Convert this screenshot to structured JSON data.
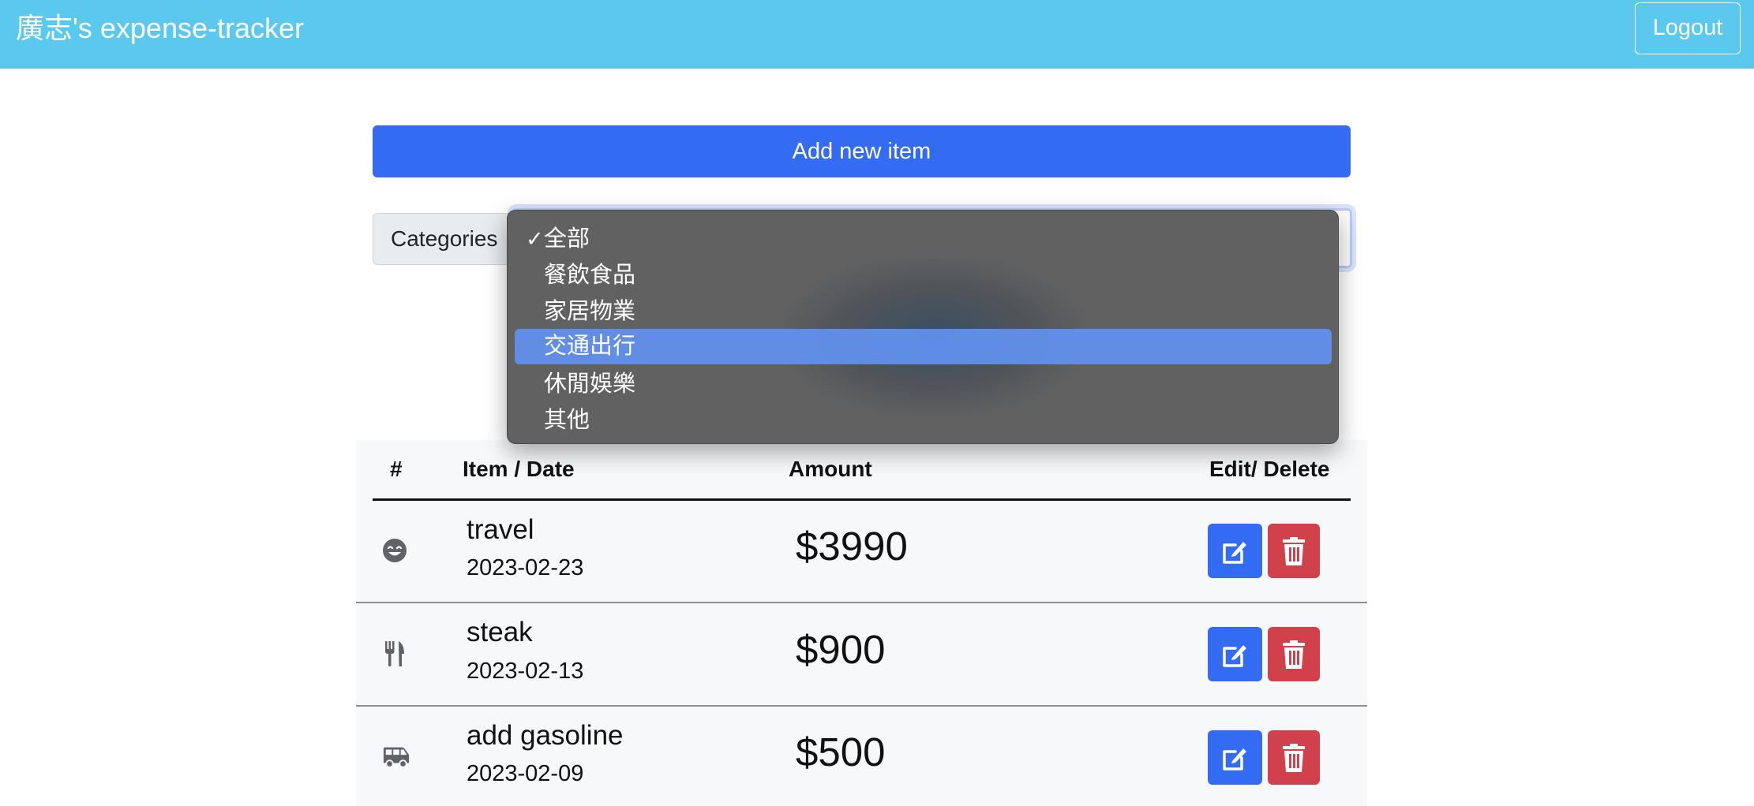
{
  "navbar": {
    "brand": "廣志's expense-tracker",
    "logout_label": "Logout",
    "color": "#5bc8ed"
  },
  "add_item_label": "Add new item",
  "filter": {
    "label": "Categories",
    "options": [
      {
        "label": "全部",
        "checked": true
      },
      {
        "label": "餐飲食品"
      },
      {
        "label": "家居物業"
      },
      {
        "label": "交通出行",
        "highlighted": true
      },
      {
        "label": "休閒娛樂"
      },
      {
        "label": "其他"
      }
    ]
  },
  "table": {
    "headers": [
      "#",
      "Item / Date",
      "Amount",
      "Edit/ Delete"
    ],
    "rows": [
      {
        "icon": "smile-icon",
        "name": "travel",
        "date": "2023-02-23",
        "amount": "$3990"
      },
      {
        "icon": "utensils-icon",
        "name": "steak",
        "date": "2023-02-13",
        "amount": "$900"
      },
      {
        "icon": "shuttle-van-icon",
        "name": "add gasoline",
        "date": "2023-02-09",
        "amount": "$500"
      }
    ]
  },
  "colors": {
    "primary": "#336cf2",
    "danger": "#d1414c"
  }
}
